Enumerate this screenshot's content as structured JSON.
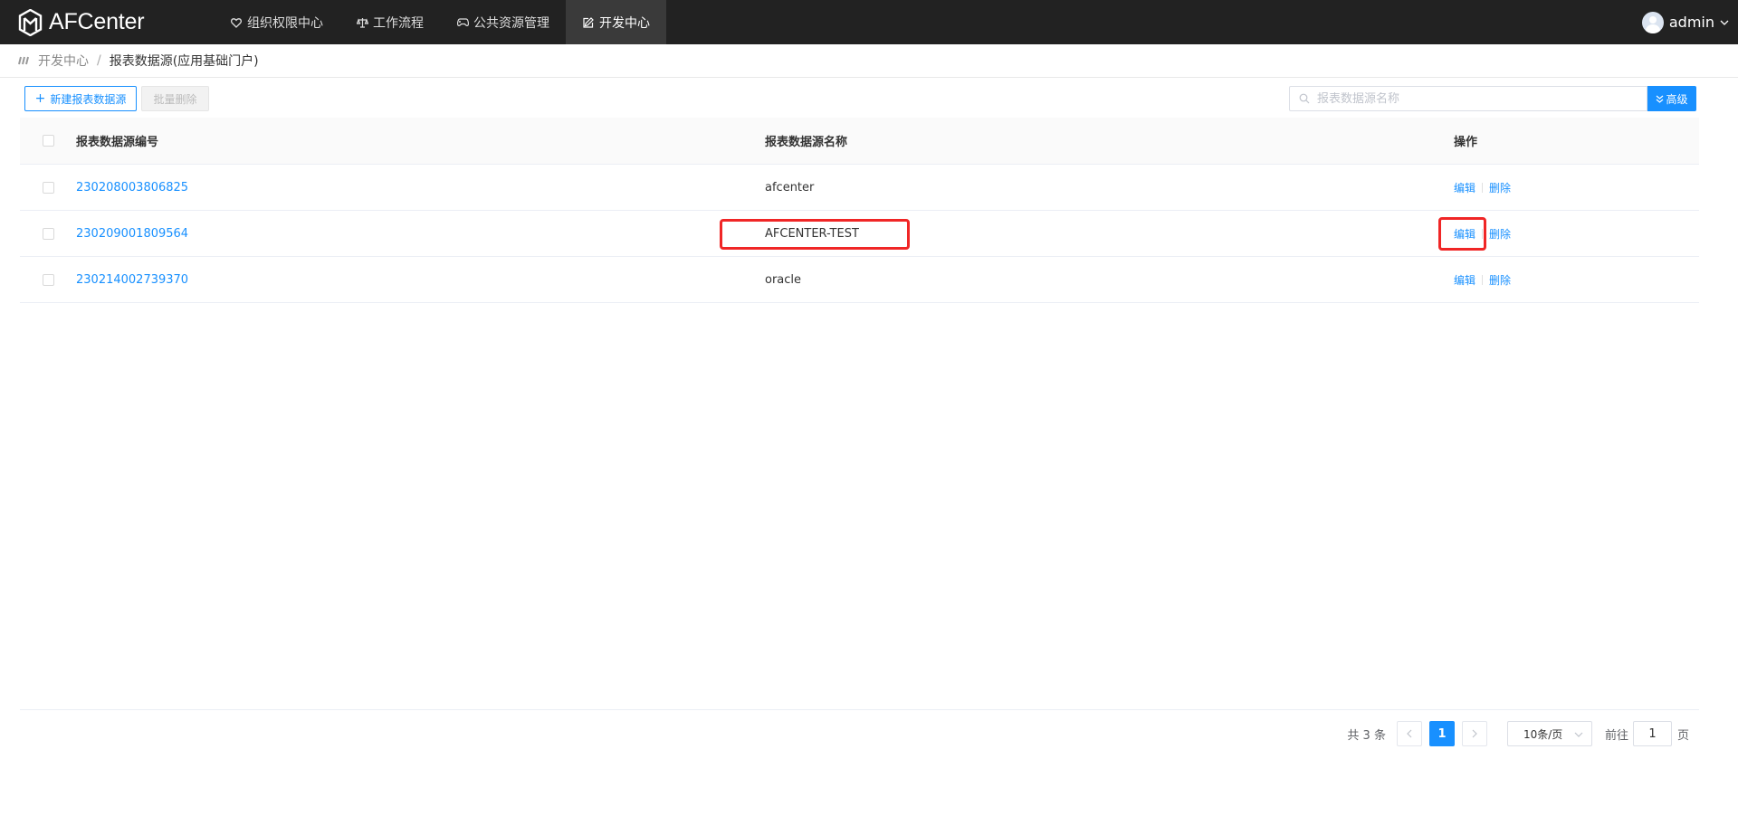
{
  "app": {
    "title": "AFCenter"
  },
  "nav": {
    "items": [
      {
        "label": "组织权限中心",
        "icon": "heart-shield-icon"
      },
      {
        "label": "工作流程",
        "icon": "scale-icon"
      },
      {
        "label": "公共资源管理",
        "icon": "gamepad-icon"
      },
      {
        "label": "开发中心",
        "icon": "edit-icon"
      }
    ],
    "active_index": 3
  },
  "user": {
    "name": "admin"
  },
  "breadcrumb": {
    "root": "开发中心",
    "separator": "/",
    "current": "报表数据源(应用基础门户)"
  },
  "toolbar": {
    "new_label": "新建报表数据源",
    "batch_delete_label": "批量删除",
    "search_placeholder": "报表数据源名称",
    "advanced_label": "高级"
  },
  "table": {
    "columns": [
      "报表数据源编号",
      "报表数据源名称",
      "操作"
    ],
    "rows": [
      {
        "id": "230208003806825",
        "name": "afcenter",
        "edit": "编辑",
        "delete": "删除"
      },
      {
        "id": "230209001809564",
        "name": "AFCENTER-TEST",
        "edit": "编辑",
        "delete": "删除"
      },
      {
        "id": "230214002739370",
        "name": "oracle",
        "edit": "编辑",
        "delete": "删除"
      }
    ]
  },
  "pagination": {
    "total_text": "共 3 条",
    "current_page": "1",
    "page_size": "10条/页",
    "goto_label": "前往",
    "goto_value": "1",
    "page_unit": "页"
  },
  "colors": {
    "accent": "#1890ff",
    "topbar": "#222222",
    "highlight": "#f02626"
  }
}
